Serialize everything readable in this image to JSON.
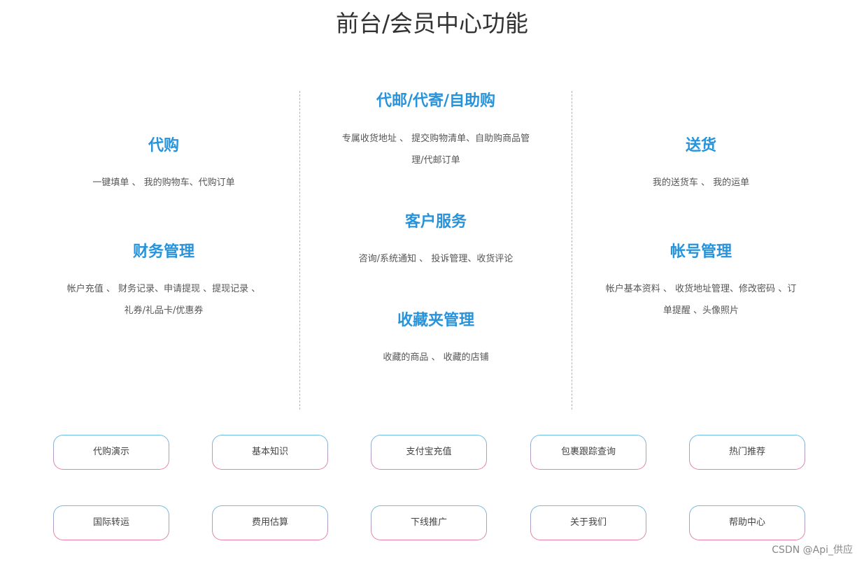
{
  "page": {
    "title": "前台/会员中心功能"
  },
  "left": {
    "daigou": {
      "title": "代购",
      "desc": "一键填单 、 我的购物车、代购订单"
    },
    "caiwu": {
      "title": "财务管理",
      "desc_line1": "帐户充值 、 财务记录、申请提现 、提现记录 、",
      "desc_line2": "礼券/礼品卡/优惠券"
    }
  },
  "middle": {
    "daiyou": {
      "title": "代邮/代寄/自助购",
      "desc_line1": "专属收货地址 、 提交购物清单、自助购商品管",
      "desc_line2": "理/代邮订单"
    },
    "kefu": {
      "title": "客户服务",
      "desc": "咨询/系统通知 、 投诉管理、收货评论"
    },
    "shoucang": {
      "title": "收藏夹管理",
      "desc": "收藏的商品 、 收藏的店铺"
    }
  },
  "right": {
    "songhuo": {
      "title": "送货",
      "desc": "我的送货车 、 我的运单"
    },
    "zhanghao": {
      "title": "帐号管理",
      "desc_line1": "帐户基本资料 、 收货地址管理、修改密码 、订",
      "desc_line2": "单提醒 、头像照片"
    }
  },
  "buttons": {
    "row1": [
      "代购演示",
      "基本知识",
      "支付宝充值",
      "包裹跟踪查询",
      "热门推荐"
    ],
    "row2": [
      "国际转运",
      "费用估算",
      "下线推广",
      "关于我们",
      "帮助中心"
    ]
  },
  "watermark": "CSDN @Api_供应",
  "colors": {
    "accent": "#2793db",
    "border_top": "#6bbfe6",
    "border_bottom": "#f07ea2"
  }
}
